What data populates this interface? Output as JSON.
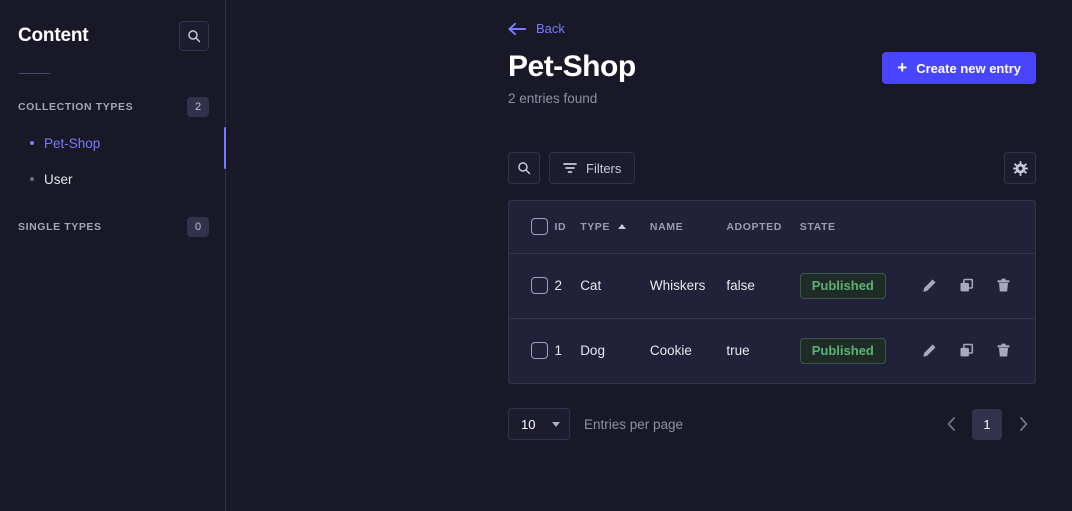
{
  "sidebar": {
    "title": "Content",
    "search_icon": "search-icon",
    "sections": [
      {
        "label": "COLLECTION TYPES",
        "badge": "2",
        "items": [
          {
            "label": "Pet-Shop",
            "active": true
          },
          {
            "label": "User",
            "active": false
          }
        ]
      },
      {
        "label": "SINGLE TYPES",
        "badge": "0",
        "items": []
      }
    ]
  },
  "main": {
    "back_label": "Back",
    "page_title": "Pet-Shop",
    "entries_found": "2 entries found",
    "create_button": {
      "label": "Create new entry",
      "plus": "+"
    },
    "toolbar": {
      "search_icon": "search-icon",
      "filters_label": "Filters",
      "filters_icon": "filter-icon",
      "settings_icon": "gear-icon"
    },
    "table": {
      "columns": [
        {
          "key": "id",
          "label": "ID",
          "sorted": false
        },
        {
          "key": "type",
          "label": "TYPE",
          "sorted": true,
          "direction": "asc"
        },
        {
          "key": "name",
          "label": "NAME",
          "sorted": false
        },
        {
          "key": "adopted",
          "label": "ADOPTED",
          "sorted": false
        },
        {
          "key": "state",
          "label": "STATE",
          "sorted": false
        }
      ],
      "rows": [
        {
          "id": "2",
          "type": "Cat",
          "name": "Whiskers",
          "adopted": "false",
          "state": "Published"
        },
        {
          "id": "1",
          "type": "Dog",
          "name": "Cookie",
          "adopted": "true",
          "state": "Published"
        }
      ],
      "row_actions": [
        "edit-icon",
        "duplicate-icon",
        "delete-icon"
      ]
    },
    "pagination": {
      "per_page_value": "10",
      "per_page_label": "Entries per page",
      "current_page": "1",
      "prev_icon": "chevron-left-icon",
      "next_icon": "chevron-right-icon"
    }
  },
  "colors": {
    "page_bg": "#181826",
    "card_bg": "#21213a",
    "border": "#32324d",
    "accent": "#4945ff",
    "accent_link": "#7b79ff",
    "success": "#5cb176",
    "muted_text": "#8e8ea9"
  }
}
